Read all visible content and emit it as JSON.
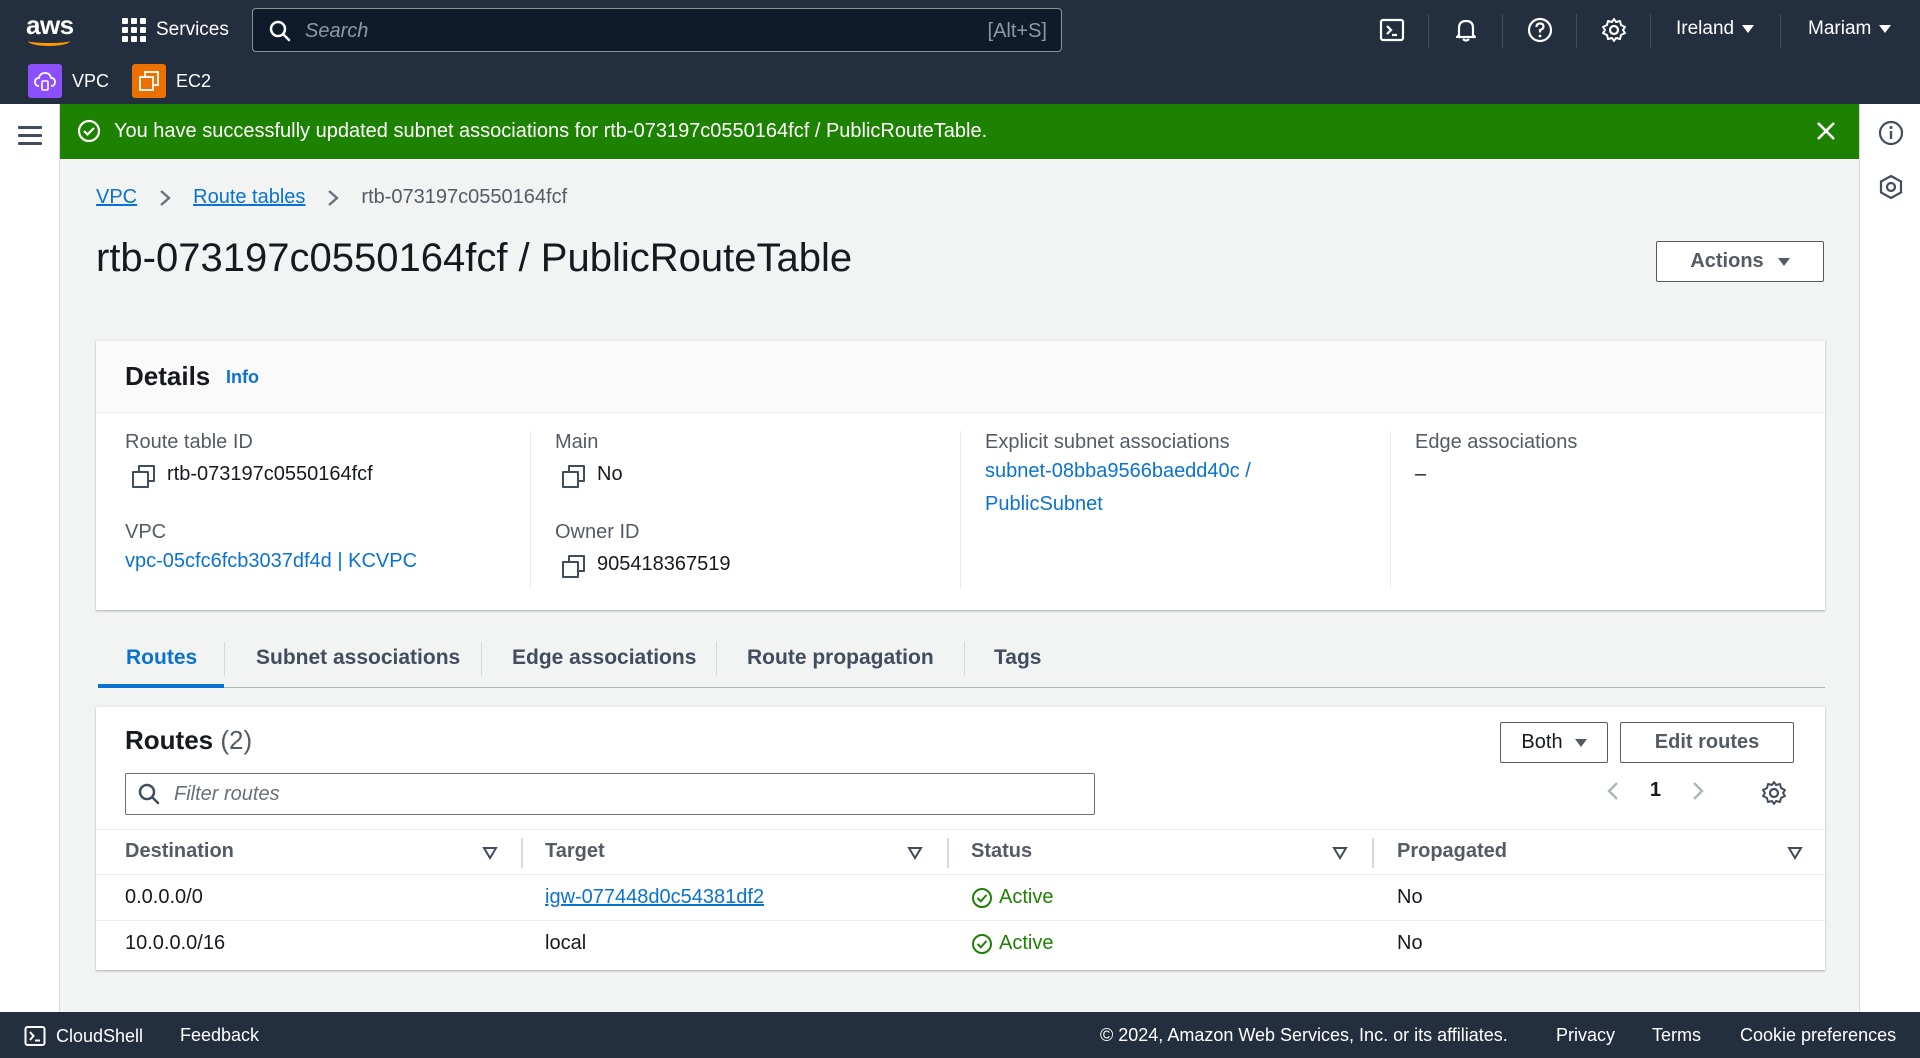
{
  "topnav": {
    "logo": "aws",
    "services_label": "Services",
    "search_placeholder": "Search",
    "search_shortcut": "[Alt+S]",
    "region_label": "Ireland",
    "user_label": "Mariam",
    "favorites": [
      {
        "label": "VPC",
        "icon": "vpc-icon",
        "color": "#8c4fff"
      },
      {
        "label": "EC2",
        "icon": "ec2-icon",
        "color": "#ed7100"
      }
    ]
  },
  "flash": {
    "message": "You have successfully updated subnet associations for rtb-073197c0550164fcf / PublicRouteTable.",
    "color": "#1d8102"
  },
  "breadcrumb": {
    "items": [
      "VPC",
      "Route tables"
    ],
    "current": "rtb-073197c0550164fcf"
  },
  "page": {
    "title": "rtb-073197c0550164fcf / PublicRouteTable",
    "actions_label": "Actions"
  },
  "details": {
    "title": "Details",
    "info_label": "Info",
    "route_table_id_label": "Route table ID",
    "route_table_id": "rtb-073197c0550164fcf",
    "vpc_label": "VPC",
    "vpc_value": "vpc-05cfc6fcb3037df4d | KCVPC",
    "main_label": "Main",
    "main_value": "No",
    "owner_label": "Owner ID",
    "owner_value": "905418367519",
    "explicit_label": "Explicit subnet associations",
    "explicit_line1": "subnet-08bba9566baedd40c /",
    "explicit_line2": "PublicSubnet",
    "edge_label": "Edge associations",
    "edge_value": "–"
  },
  "tabs": [
    "Routes",
    "Subnet associations",
    "Edge associations",
    "Route propagation",
    "Tags"
  ],
  "routes": {
    "title": "Routes",
    "count": "(2)",
    "filter_label": "Both",
    "edit_label": "Edit routes",
    "filter_placeholder": "Filter routes",
    "page": "1",
    "columns": [
      "Destination",
      "Target",
      "Status",
      "Propagated"
    ],
    "rows": [
      {
        "destination": "0.0.0.0/0",
        "target": "igw-077448d0c54381df2",
        "target_link": true,
        "status": "Active",
        "propagated": "No"
      },
      {
        "destination": "10.0.0.0/16",
        "target": "local",
        "target_link": false,
        "status": "Active",
        "propagated": "No"
      }
    ]
  },
  "footer": {
    "cloudshell": "CloudShell",
    "feedback": "Feedback",
    "copyright": "© 2024, Amazon Web Services, Inc. or its affiliates.",
    "privacy": "Privacy",
    "terms": "Terms",
    "cookies": "Cookie preferences"
  }
}
